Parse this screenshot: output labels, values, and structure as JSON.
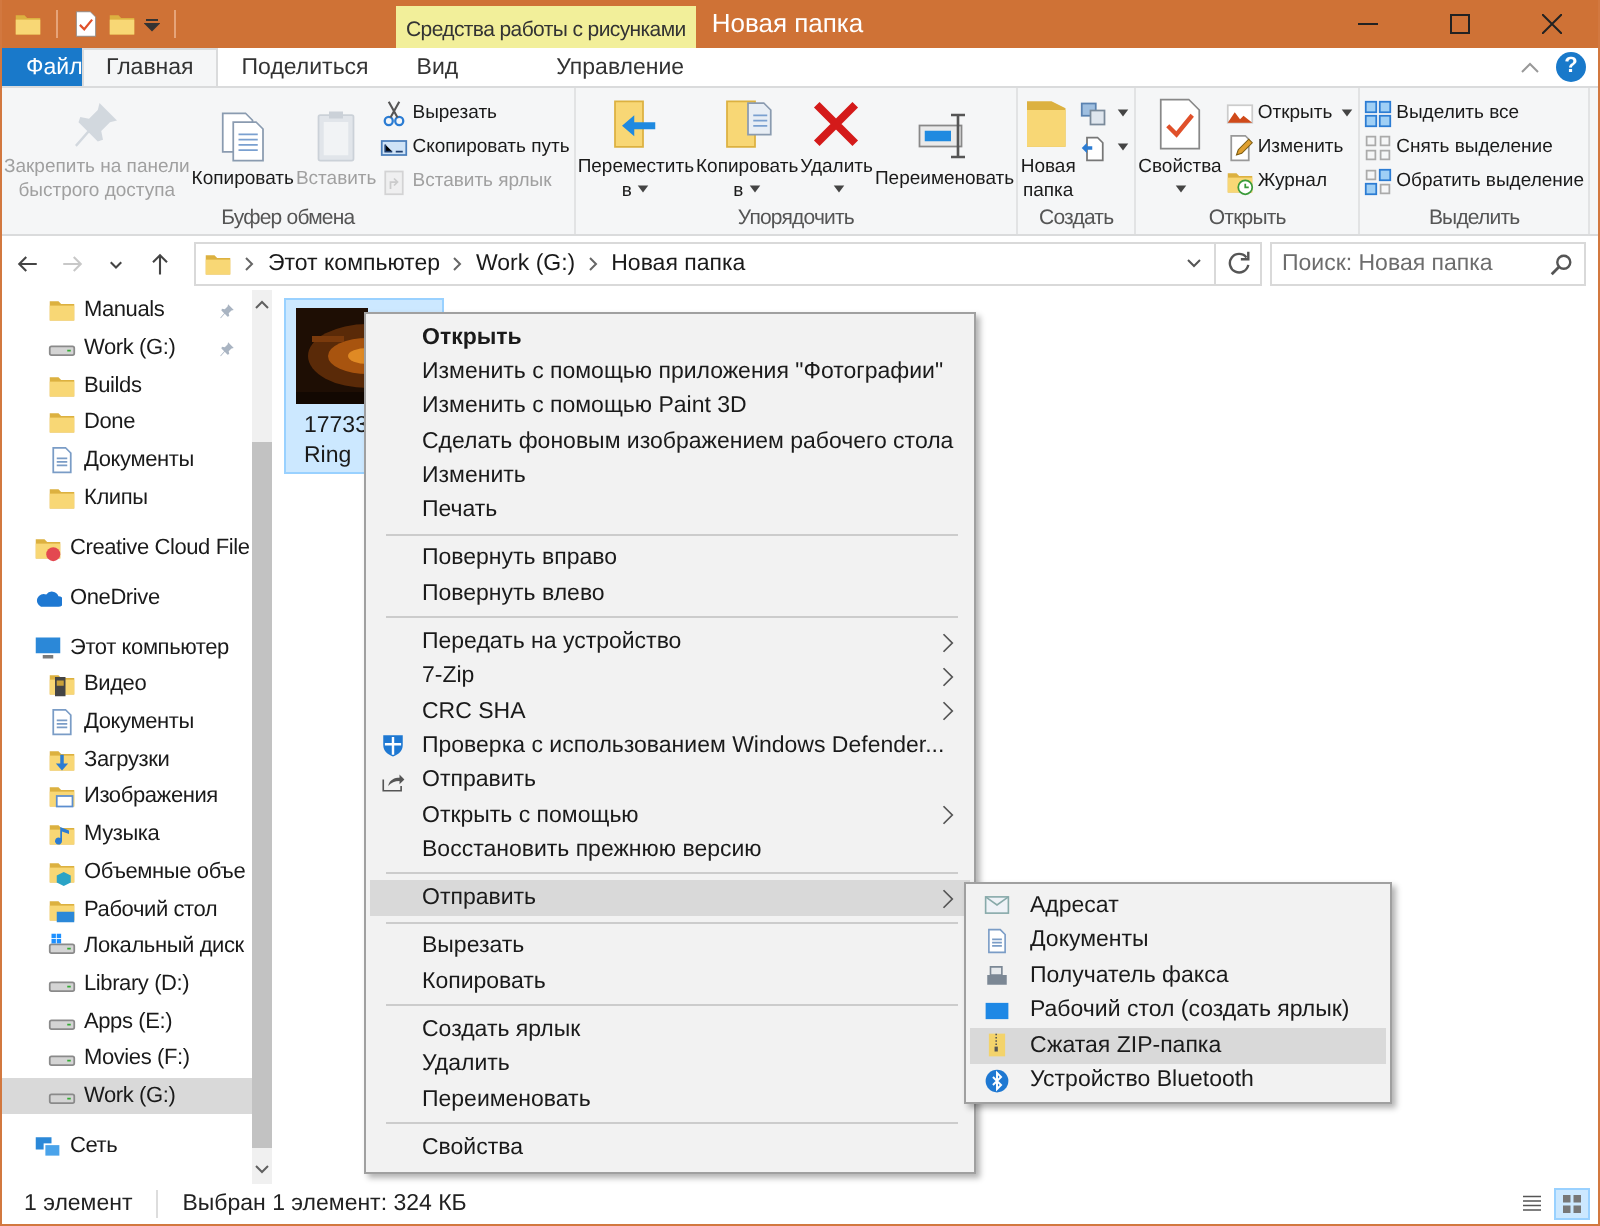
{
  "window": {
    "title": "Новая папка",
    "context_tab": "Средства работы с рисунками"
  },
  "ribbon_tabs": [
    {
      "label": "Файл",
      "kind": "file",
      "selected": false
    },
    {
      "label": "Главная",
      "kind": "normal",
      "selected": true
    },
    {
      "label": "Поделиться",
      "kind": "normal",
      "selected": false
    },
    {
      "label": "Вид",
      "kind": "normal",
      "selected": false
    },
    {
      "label": "Управление",
      "kind": "contextual",
      "selected": false
    }
  ],
  "help_button": "?",
  "ribbon_groups": [
    {
      "label": "Буфер обмена",
      "large": [
        {
          "kind": "pin",
          "label": "Закрепить на панели\nбыстрого доступа",
          "disabled": true
        },
        {
          "kind": "copy",
          "label": "Копировать",
          "disabled": false
        },
        {
          "kind": "paste",
          "label": "Вставить",
          "disabled": true
        }
      ],
      "small": [
        {
          "kind": "cut",
          "label": "Вырезать",
          "disabled": false
        },
        {
          "kind": "copypath",
          "label": "Скопировать путь",
          "disabled": false
        },
        {
          "kind": "pasteshortcut",
          "label": "Вставить ярлык",
          "disabled": true
        }
      ]
    },
    {
      "label": "Упорядочить",
      "large": [
        {
          "kind": "move",
          "label": "Переместить\nв",
          "disabled": false,
          "dropdown": true
        },
        {
          "kind": "copyto",
          "label": "Копировать\nв",
          "disabled": false,
          "dropdown": true
        },
        {
          "kind": "delete",
          "label": "Удалить",
          "disabled": false,
          "dropdown": true
        },
        {
          "kind": "rename",
          "label": "Переименовать",
          "disabled": false
        }
      ]
    },
    {
      "label": "Создать",
      "large": [
        {
          "kind": "newfolder",
          "label": "Новая\nпапка",
          "disabled": false
        }
      ],
      "small": [
        {
          "kind": "newitem",
          "disabled": false,
          "dropdown": true
        },
        {
          "kind": "easyaccess",
          "disabled": false,
          "dropdown": true
        }
      ]
    },
    {
      "label": "Открыть",
      "large": [
        {
          "kind": "properties",
          "label": "Свойства",
          "disabled": false,
          "dropdown": true
        }
      ],
      "small": [
        {
          "kind": "open",
          "label": "Открыть",
          "disabled": false,
          "dropdown": true
        },
        {
          "kind": "edit",
          "label": "Изменить",
          "disabled": false
        },
        {
          "kind": "history",
          "label": "Журнал",
          "disabled": false
        }
      ]
    },
    {
      "label": "Выделить",
      "small": [
        {
          "kind": "selectall",
          "label": "Выделить все",
          "disabled": false
        },
        {
          "kind": "selectnone",
          "label": "Снять выделение",
          "disabled": false
        },
        {
          "kind": "invert",
          "label": "Обратить выделение",
          "disabled": false
        }
      ]
    }
  ],
  "nav_buttons": [
    {
      "kind": "back",
      "disabled": false
    },
    {
      "kind": "forward",
      "disabled": true
    },
    {
      "kind": "recent",
      "disabled": false
    },
    {
      "kind": "up",
      "disabled": false
    }
  ],
  "breadcrumbs": [
    "Этот компьютер",
    "Work (G:)",
    "Новая папка"
  ],
  "search": {
    "placeholder": "Поиск: Новая папка"
  },
  "nav_pane": {
    "quick_access": [
      {
        "label": "Manuals",
        "kind": "folder",
        "pinned": true,
        "selected": false
      },
      {
        "label": "Work (G:)",
        "kind": "drive",
        "pinned": true,
        "selected": false
      },
      {
        "label": "Builds",
        "kind": "folder",
        "selected": false
      },
      {
        "label": "Done",
        "kind": "folder",
        "selected": false
      },
      {
        "label": "Документы",
        "kind": "documents",
        "selected": false
      },
      {
        "label": "Клипы",
        "kind": "folder",
        "selected": false
      }
    ],
    "items": [
      {
        "label": "Creative Cloud File",
        "kind": "cc",
        "selected": false
      },
      {
        "label": "OneDrive",
        "kind": "onedrive",
        "selected": false
      },
      {
        "label": "Этот компьютер",
        "kind": "computer",
        "selected": false,
        "children": [
          {
            "label": "Видео",
            "kind": "video",
            "selected": false
          },
          {
            "label": "Документы",
            "kind": "documents",
            "selected": false
          },
          {
            "label": "Загрузки",
            "kind": "downloads",
            "selected": false
          },
          {
            "label": "Изображения",
            "kind": "pictures",
            "selected": false
          },
          {
            "label": "Музыка",
            "kind": "music",
            "selected": false
          },
          {
            "label": "Объемные объе",
            "kind": "objects3d",
            "selected": false
          },
          {
            "label": "Рабочий стол",
            "kind": "desktop",
            "selected": false
          },
          {
            "label": "Локальный диск",
            "kind": "windrive",
            "selected": false
          },
          {
            "label": "Library (D:)",
            "kind": "drive",
            "selected": false
          },
          {
            "label": "Apps (E:)",
            "kind": "drive",
            "selected": false
          },
          {
            "label": "Movies (F:)",
            "kind": "drive",
            "selected": false
          },
          {
            "label": "Work (G:)",
            "kind": "drive",
            "selected": true
          }
        ]
      },
      {
        "label": "Сеть",
        "kind": "network",
        "selected": false
      }
    ]
  },
  "files": [
    {
      "kind": "picture",
      "name_lines": [
        "17733",
        "Ring"
      ],
      "selected": true
    }
  ],
  "context_menu": {
    "sections": [
      [
        {
          "label": "Открыть",
          "kind": "default",
          "selected": false
        },
        {
          "label": "Изменить с помощью приложения \"Фотографии\"",
          "kind": "plain",
          "selected": false
        },
        {
          "label": "Изменить с помощью Paint 3D",
          "kind": "plain",
          "selected": false
        },
        {
          "label": "Сделать фоновым изображением рабочего стола",
          "kind": "plain",
          "selected": false
        },
        {
          "label": "Изменить",
          "kind": "plain",
          "selected": false
        },
        {
          "label": "Печать",
          "kind": "plain",
          "selected": false
        }
      ],
      [
        {
          "label": "Повернуть вправо",
          "kind": "plain",
          "selected": false
        },
        {
          "label": "Повернуть влево",
          "kind": "plain",
          "selected": false
        }
      ],
      [
        {
          "label": "Передать на устройство",
          "kind": "submenu",
          "selected": false
        },
        {
          "label": "7-Zip",
          "kind": "submenu",
          "selected": false
        },
        {
          "label": "CRC SHA",
          "kind": "submenu",
          "selected": false
        },
        {
          "label": "Проверка с использованием Windows Defender...",
          "kind": "defender",
          "selected": false
        },
        {
          "label": "Отправить",
          "kind": "share",
          "selected": false
        },
        {
          "label": "Открыть с помощью",
          "kind": "submenu",
          "selected": false
        },
        {
          "label": "Восстановить прежнюю версию",
          "kind": "plain",
          "selected": false
        }
      ],
      [
        {
          "label": "Отправить",
          "kind": "submenu",
          "selected": true
        }
      ],
      [
        {
          "label": "Вырезать",
          "kind": "plain",
          "selected": false
        },
        {
          "label": "Копировать",
          "kind": "plain",
          "selected": false
        }
      ],
      [
        {
          "label": "Создать ярлык",
          "kind": "plain",
          "selected": false
        },
        {
          "label": "Удалить",
          "kind": "plain",
          "selected": false
        },
        {
          "label": "Переименовать",
          "kind": "plain",
          "selected": false
        }
      ],
      [
        {
          "label": "Свойства",
          "kind": "plain",
          "selected": false
        }
      ]
    ]
  },
  "send_to_menu": [
    {
      "label": "Адресат",
      "kind": "mail",
      "selected": false
    },
    {
      "label": "Документы",
      "kind": "documents",
      "selected": false
    },
    {
      "label": "Получатель факса",
      "kind": "fax",
      "selected": false
    },
    {
      "label": "Рабочий стол (создать ярлык)",
      "kind": "desktop",
      "selected": false
    },
    {
      "label": "Сжатая ZIP-папка",
      "kind": "zip",
      "selected": true
    },
    {
      "label": "Устройство Bluetooth",
      "kind": "bluetooth",
      "selected": false
    }
  ],
  "status_bar": {
    "count": "1 элемент",
    "selection": "Выбран 1 элемент: 324 КБ",
    "views": [
      {
        "kind": "details",
        "selected": false
      },
      {
        "kind": "tiles",
        "selected": true
      }
    ]
  }
}
